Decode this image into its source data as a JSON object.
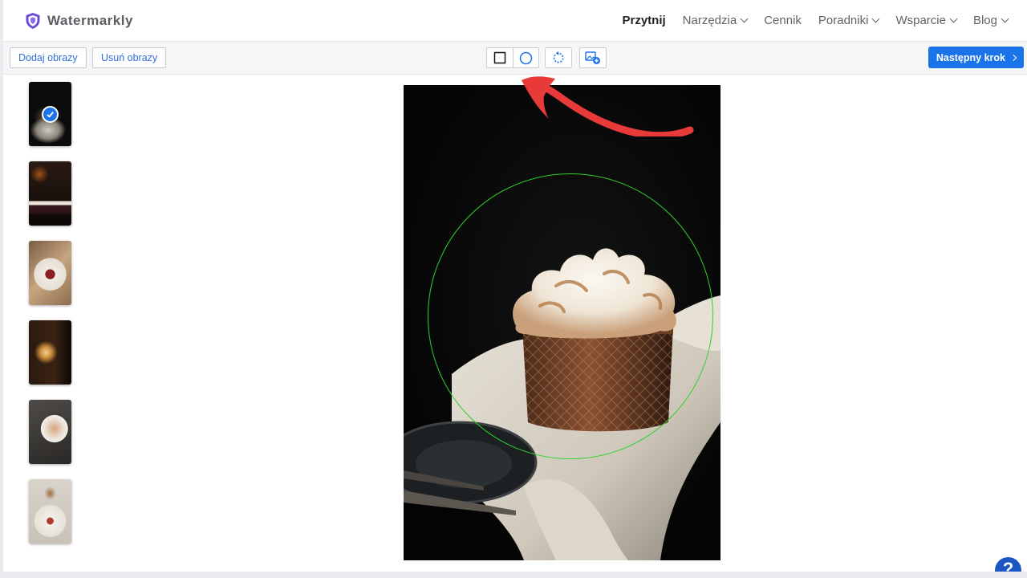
{
  "app": {
    "name": "Watermarkly"
  },
  "nav": {
    "items": [
      {
        "label": "Przytnij",
        "active": true,
        "dropdown": false
      },
      {
        "label": "Narzędzia",
        "active": false,
        "dropdown": true
      },
      {
        "label": "Cennik",
        "active": false,
        "dropdown": false
      },
      {
        "label": "Poradniki",
        "active": false,
        "dropdown": true
      },
      {
        "label": "Wsparcie",
        "active": false,
        "dropdown": true
      },
      {
        "label": "Blog",
        "active": false,
        "dropdown": true
      }
    ]
  },
  "toolbar": {
    "add_label": "Dodaj obrazy",
    "remove_label": "Usuń obrazy",
    "tools": [
      "rectangle-crop-icon",
      "circle-crop-icon",
      "rotate-icon",
      "add-image-icon"
    ],
    "next_label": "Następny krok"
  },
  "thumbnails": [
    {
      "selected": true,
      "desc": "meringue cake"
    },
    {
      "selected": false,
      "desc": "cake slice"
    },
    {
      "selected": false,
      "desc": "dessert plate"
    },
    {
      "selected": false,
      "desc": "candle"
    },
    {
      "selected": false,
      "desc": "pastry plate"
    },
    {
      "selected": false,
      "desc": "table setting"
    }
  ],
  "canvas": {
    "crop_shape": "circle"
  },
  "help": {
    "label": "?"
  },
  "colors": {
    "accent": "#1a73e8",
    "crop_outline": "#2ed12e",
    "annotation": "#e93a3a",
    "logo": "#6b4bd8"
  }
}
